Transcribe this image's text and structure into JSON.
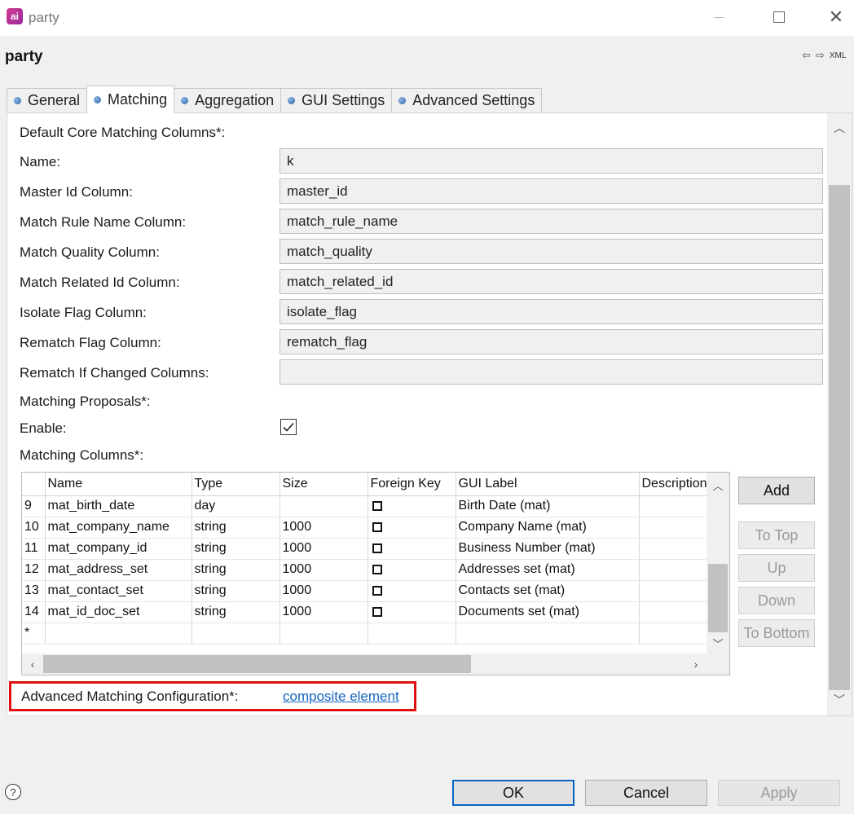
{
  "window": {
    "app_icon": "ai",
    "title": "party"
  },
  "header": {
    "title": "party",
    "nav_back_icon": "arrow-left-icon",
    "nav_forward_icon": "arrow-right-icon",
    "xml_label": "XML"
  },
  "tabs": [
    {
      "label": "General",
      "active": false
    },
    {
      "label": "Matching",
      "active": true
    },
    {
      "label": "Aggregation",
      "active": false
    },
    {
      "label": "GUI Settings",
      "active": false
    },
    {
      "label": "Advanced Settings",
      "active": false
    }
  ],
  "form": {
    "section_core": "Default Core Matching Columns*:",
    "fields": [
      {
        "label": "Name:",
        "value": "k"
      },
      {
        "label": "Master Id Column:",
        "value": "master_id"
      },
      {
        "label": "Match Rule Name Column:",
        "value": "match_rule_name"
      },
      {
        "label": "Match Quality Column:",
        "value": "match_quality"
      },
      {
        "label": "Match Related Id Column:",
        "value": "match_related_id"
      },
      {
        "label": "Isolate Flag Column:",
        "value": "isolate_flag"
      },
      {
        "label": "Rematch Flag Column:",
        "value": "rematch_flag"
      },
      {
        "label": "Rematch If Changed Columns:",
        "value": ""
      }
    ],
    "section_proposals": "Matching Proposals*:",
    "enable_label": "Enable:",
    "enable_checked": true,
    "section_columns": "Matching Columns*:"
  },
  "table": {
    "headers": [
      "",
      "Name",
      "Type",
      "Size",
      "Foreign Key",
      "GUI Label",
      "Description"
    ],
    "rows": [
      {
        "num": "9",
        "name": "mat_birth_date",
        "type": "day",
        "size": "",
        "fk": false,
        "gui_label": "Birth Date (mat)",
        "description": ""
      },
      {
        "num": "10",
        "name": "mat_company_name",
        "type": "string",
        "size": "1000",
        "fk": false,
        "gui_label": "Company Name (mat)",
        "description": ""
      },
      {
        "num": "11",
        "name": "mat_company_id",
        "type": "string",
        "size": "1000",
        "fk": false,
        "gui_label": "Business Number (mat)",
        "description": ""
      },
      {
        "num": "12",
        "name": "mat_address_set",
        "type": "string",
        "size": "1000",
        "fk": false,
        "gui_label": "Addresses set (mat)",
        "description": ""
      },
      {
        "num": "13",
        "name": "mat_contact_set",
        "type": "string",
        "size": "1000",
        "fk": false,
        "gui_label": "Contacts set (mat)",
        "description": ""
      },
      {
        "num": "14",
        "name": "mat_id_doc_set",
        "type": "string",
        "size": "1000",
        "fk": false,
        "gui_label": "Documents set (mat)",
        "description": ""
      }
    ],
    "new_row_marker": "*"
  },
  "side_buttons": {
    "add": "Add",
    "to_top": "To Top",
    "up": "Up",
    "down": "Down",
    "to_bottom": "To Bottom"
  },
  "advanced": {
    "label": "Advanced Matching Configuration*:",
    "link": "composite element",
    "highlight_color": "#e01010"
  },
  "footer": {
    "help": "?",
    "ok": "OK",
    "cancel": "Cancel",
    "apply": "Apply"
  },
  "colors": {
    "link": "#1565c0",
    "default_button_border": "#0a64c8",
    "app_icon": "#c4338f"
  }
}
